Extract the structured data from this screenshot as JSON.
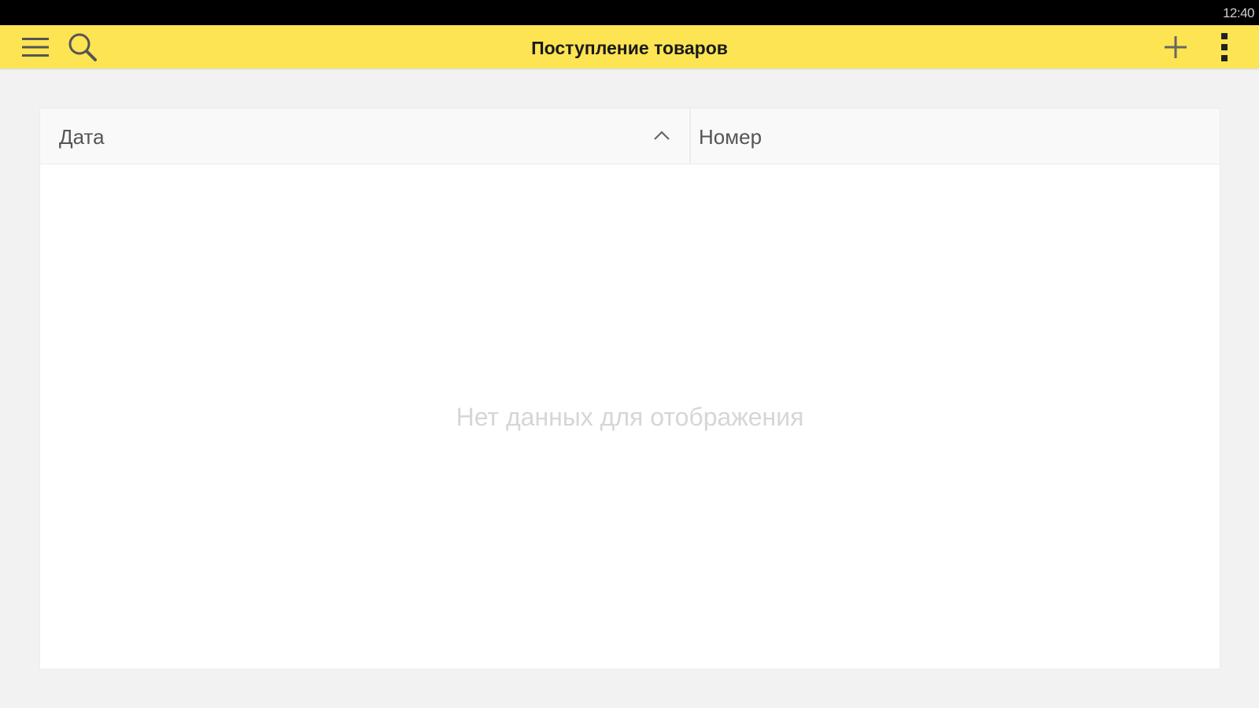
{
  "status_bar": {
    "time": "12:40"
  },
  "app_bar": {
    "title": "Поступление товаров",
    "background_color": "#fde452",
    "icons": {
      "left": [
        "menu-icon",
        "search-icon"
      ],
      "right": [
        "plus-icon",
        "more-vertical-icon"
      ]
    }
  },
  "table": {
    "columns": [
      {
        "label": "Дата",
        "sort": "ascending"
      },
      {
        "label": "Номер"
      }
    ],
    "rows": [],
    "empty_message": "Нет данных для отображения"
  }
}
